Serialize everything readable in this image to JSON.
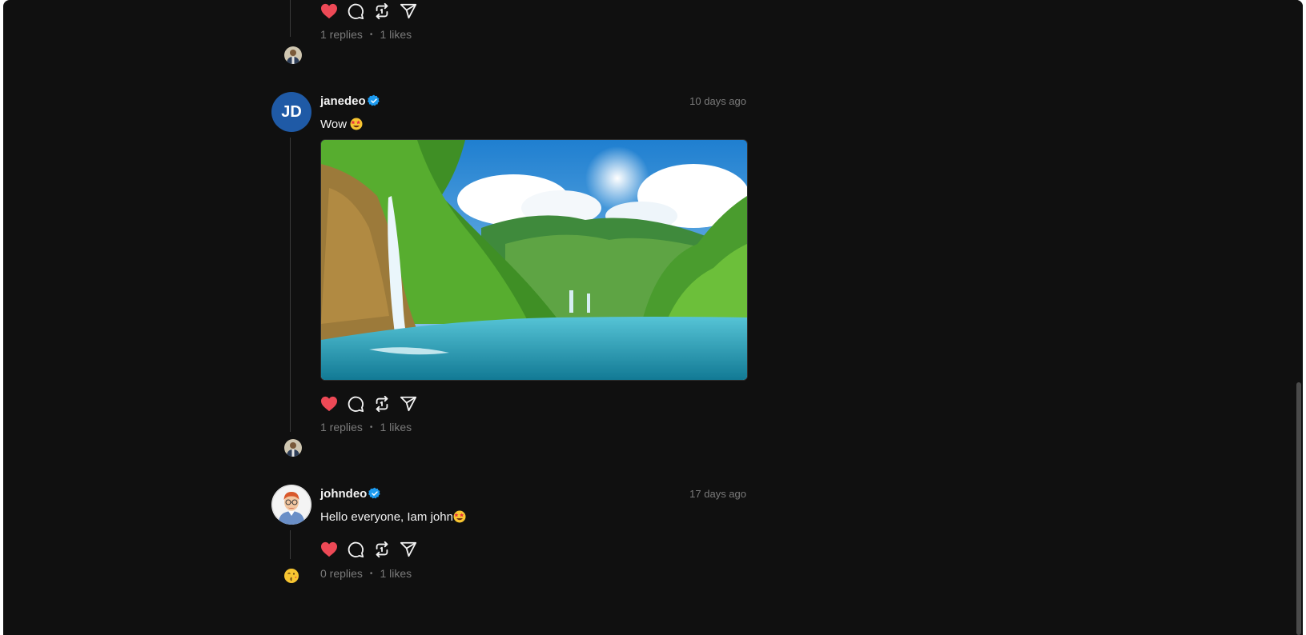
{
  "posts": [
    {
      "replies_label": "1 replies",
      "likes_label": "1 likes"
    },
    {
      "avatar_initials": "JD",
      "username": "janedeo",
      "timestamp": "10 days ago",
      "text": "Wow",
      "replies_label": "1 replies",
      "likes_label": "1 likes"
    },
    {
      "username": "johndeo",
      "timestamp": "17 days ago",
      "text": "Hello everyone, Iam john",
      "replies_label": "0 replies",
      "likes_label": "1 likes"
    }
  ],
  "stats_separator": "•",
  "icons": [
    "heart-icon",
    "comment-icon",
    "repost-icon",
    "share-icon",
    "verified-badge-icon",
    "star-struck-emoji"
  ],
  "colors": {
    "background": "#101010",
    "like": "#ed4956",
    "verified": "#1d9bf0",
    "avatar_initials_bg": "#1f5aa6",
    "muted_text": "#7a7a7a"
  }
}
